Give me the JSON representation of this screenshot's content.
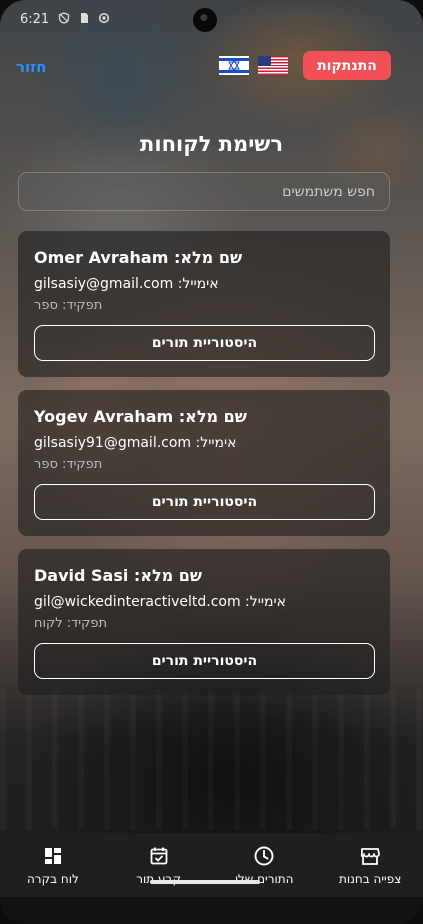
{
  "status_bar": {
    "time": "6:21"
  },
  "header": {
    "back_label": "חזור",
    "logout_label": "התנתקות"
  },
  "page": {
    "title": "רשימת לקוחות",
    "search_placeholder": "חפש משתמשים"
  },
  "customers": [
    {
      "name": "Omer Avraham :שם מלא",
      "email": "gilsasiy@gmail.com :אימייל",
      "role": "תפקיד: ספר",
      "history_label": "היסטוריית תורים"
    },
    {
      "name": "Yogev Avraham :שם מלא",
      "email": "gilsasiy91@gmail.com :אימייל",
      "role": "תפקיד: ספר",
      "history_label": "היסטוריית תורים"
    },
    {
      "name": "David Sasi :שם מלא",
      "email": "gil@wickedinteractiveltd.com :אימייל",
      "role": "תפקיד: לקוח",
      "history_label": "היסטוריית תורים"
    }
  ],
  "nav": [
    {
      "label": "צפייה בחנות",
      "icon": "store-icon"
    },
    {
      "label": "התורים שלי",
      "icon": "clock-icon"
    },
    {
      "label": "קבע תור",
      "icon": "calendar-check-icon"
    },
    {
      "label": "לוח בקרה",
      "icon": "dashboard-icon"
    }
  ],
  "colors": {
    "accent_link": "#2f8dff",
    "logout_bg": "#f25057",
    "card_bg": "rgba(30,30,30,0.62)",
    "nav_bg": "#1f1f1f"
  }
}
